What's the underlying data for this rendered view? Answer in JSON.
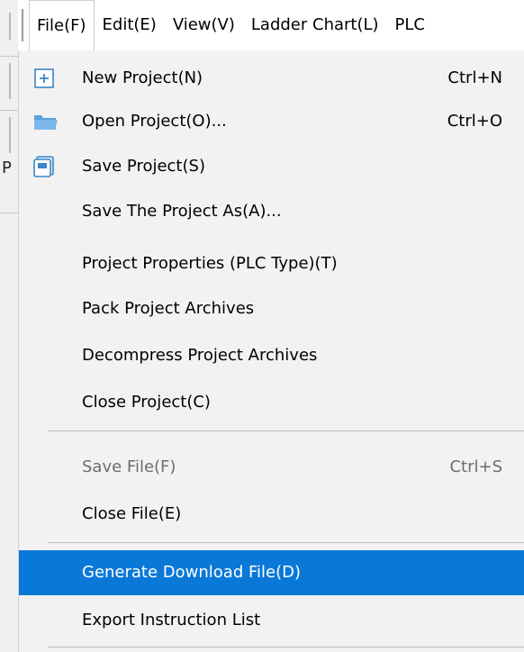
{
  "menubar": {
    "items": [
      {
        "label": "File(F)"
      },
      {
        "label": "Edit(E)"
      },
      {
        "label": "View(V)"
      },
      {
        "label": "Ladder Chart(L)"
      },
      {
        "label": "PLC"
      }
    ]
  },
  "background": {
    "partial_letter": "P"
  },
  "file_menu": {
    "highlight_color": "#0a78d7",
    "items": [
      {
        "label": "New Project(N)",
        "shortcut": "Ctrl+N",
        "icon": "new-project-icon"
      },
      {
        "label": "Open Project(O)...",
        "shortcut": "Ctrl+O",
        "icon": "folder-open-icon"
      },
      {
        "label": "Save Project(S)",
        "shortcut": "",
        "icon": "save-project-icon"
      },
      {
        "label": "Save The Project As(A)...",
        "shortcut": ""
      },
      {
        "label": "Project Properties (PLC Type)(T)",
        "shortcut": ""
      },
      {
        "label": "Pack Project Archives",
        "shortcut": ""
      },
      {
        "label": "Decompress Project Archives",
        "shortcut": ""
      },
      {
        "label": "Close Project(C)",
        "shortcut": ""
      },
      {
        "label": "Save File(F)",
        "shortcut": "Ctrl+S",
        "disabled": true
      },
      {
        "label": "Close File(E)",
        "shortcut": ""
      },
      {
        "label": "Generate Download File(D)",
        "shortcut": "",
        "highlighted": true
      },
      {
        "label": "Export Instruction List",
        "shortcut": ""
      }
    ]
  }
}
